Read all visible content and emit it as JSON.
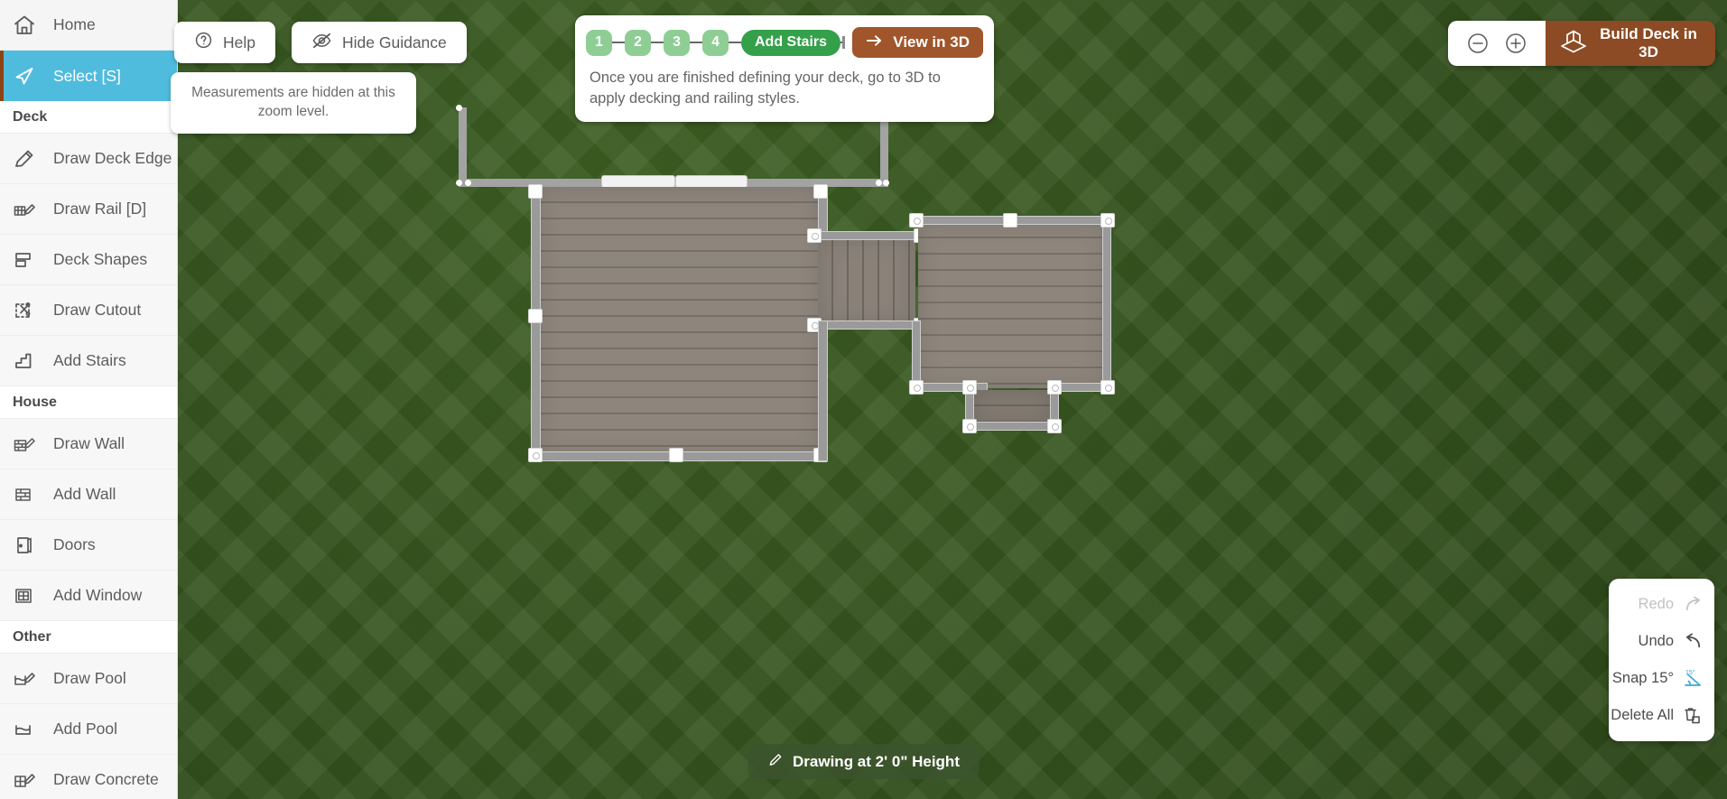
{
  "sidebar": {
    "home": {
      "label": "Home",
      "icon": "home-icon"
    },
    "select": {
      "label": "Select [S]",
      "icon": "cursor-arrow-icon"
    },
    "groups": [
      {
        "title": "Deck",
        "items": [
          {
            "label": "Draw Deck Edge",
            "icon": "pencil-icon"
          },
          {
            "label": "Draw Rail [D]",
            "icon": "rail-pencil-icon"
          },
          {
            "label": "Deck Shapes",
            "icon": "shapes-icon"
          },
          {
            "label": "Draw Cutout",
            "icon": "scissors-dashed-icon"
          },
          {
            "label": "Add Stairs",
            "icon": "stairs-icon"
          }
        ]
      },
      {
        "title": "House",
        "items": [
          {
            "label": "Draw Wall",
            "icon": "wall-pencil-icon"
          },
          {
            "label": "Add Wall",
            "icon": "brick-wall-icon"
          },
          {
            "label": "Doors",
            "icon": "door-icon"
          },
          {
            "label": "Add Window",
            "icon": "window-icon"
          }
        ]
      },
      {
        "title": "Other",
        "items": [
          {
            "label": "Draw Pool",
            "icon": "pool-pencil-icon"
          },
          {
            "label": "Add Pool",
            "icon": "pool-icon"
          },
          {
            "label": "Draw Concrete",
            "icon": "concrete-pencil-icon"
          }
        ]
      }
    ]
  },
  "toolbar": {
    "help_label": "Help",
    "help_icon": "question-circle-icon",
    "hide_guidance_label": "Hide Guidance",
    "hide_guidance_icon": "eye-slash-icon",
    "measurement_note": "Measurements are hidden at this zoom level."
  },
  "guidance": {
    "steps": [
      "1",
      "2",
      "3",
      "4"
    ],
    "current_step_label": "Add Stairs",
    "view_3d_label": "View in 3D",
    "view_3d_icon": "arrow-right-icon",
    "description": "Once you are finished defining your deck, go to 3D to apply decking and railing styles."
  },
  "topright": {
    "zoom_out_icon": "minus-circle-icon",
    "zoom_in_icon": "plus-circle-icon",
    "build_deck_label": "Build Deck in 3D",
    "build_deck_icon": "house-3d-icon"
  },
  "tools": {
    "redo": {
      "label": "Redo",
      "icon": "redo-arrow-icon",
      "enabled": false
    },
    "undo": {
      "label": "Undo",
      "icon": "undo-arrow-icon",
      "enabled": true
    },
    "snap": {
      "label": "Snap 15°",
      "icon": "snap-angle-icon",
      "enabled": true
    },
    "delete_all": {
      "label": "Delete All",
      "icon": "trash-copy-icon",
      "enabled": true
    }
  },
  "status": {
    "height_label": "Drawing at 2' 0\" Height",
    "height_icon": "pencil-icon"
  },
  "colors": {
    "accent_blue": "#4fbbdd",
    "brand_brown": "#8c4b25",
    "view3d_brown": "#a0552a",
    "step_green": "#8ece95",
    "current_step_green": "#34a04a",
    "grass_green": "#37571f",
    "deck_tan": "#8a8279"
  }
}
